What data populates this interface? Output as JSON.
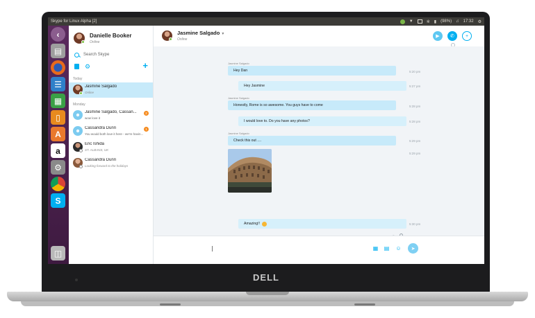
{
  "hardware": {
    "brand": "DELL"
  },
  "topbar": {
    "window_title": "Skype for Linux Alpha [2]",
    "battery": "(98%)",
    "clock": "17:32"
  },
  "launcher": {
    "items": [
      "back-icon",
      "files-icon",
      "firefox-icon",
      "writer-icon",
      "calc-icon",
      "impress-icon",
      "software-center-icon",
      "amazon-icon",
      "settings-icon",
      "chrome-icon",
      "skype-icon",
      "trash-icon"
    ]
  },
  "sidebar": {
    "me": {
      "name": "Danielle Booker",
      "status": "Online"
    },
    "search": {
      "placeholder": "Search Skype"
    },
    "sections": {
      "today": "Today",
      "monday": "Monday"
    },
    "conversations": [
      {
        "name": "Jasmine Salgado",
        "preview": "Online",
        "active": true
      },
      {
        "name": "Jasmine Salgado, Cassan...",
        "preview": "wow love it",
        "badge": "2"
      },
      {
        "name": "Cassandra Dunn",
        "preview": "You would both love it here - we're havin...",
        "badge": "1"
      },
      {
        "name": "Eric Ishida",
        "preview": "ST. ALBANS, UK"
      },
      {
        "name": "Cassandra Dunn",
        "preview": "Looking forward to the holidays"
      }
    ]
  },
  "chat": {
    "contact": {
      "name": "Jasmine Salgado",
      "status": "Online"
    },
    "messages": [
      {
        "sender": "Jasmine Salgado",
        "text": "Hey Dan",
        "time": "5:20 pm"
      },
      {
        "text": "Hey Jasmine",
        "time": "5:27 pm"
      },
      {
        "sender": "Jasmine Salgado",
        "text": "Honestly, Rome is so awesome. You guys have to come",
        "time": "5:28 pm"
      },
      {
        "text": "I would love to. Do you have any photos?",
        "time": "5:28 pm"
      },
      {
        "sender": "Jasmine Salgado",
        "text": "Check this out ....",
        "time": "5:29 pm"
      },
      {
        "time": "5:29 pm"
      },
      {
        "text": "Amazing!!",
        "time": "5:30 pm"
      }
    ],
    "seen_label": "Seen",
    "colors": {
      "accent": "#00aff0",
      "incoming_bubble": "#c7eafa",
      "outgoing_bubble": "#d6f0fb"
    }
  }
}
